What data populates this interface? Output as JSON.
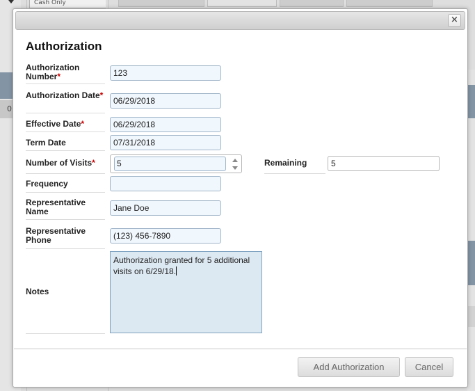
{
  "background": {
    "cash_label": "Cash Only",
    "row_value": "0"
  },
  "dialog": {
    "close_glyph": "×",
    "title": "Authorization",
    "fields": {
      "auth_number": {
        "label": "Authorization Number",
        "required": "*",
        "value": "123"
      },
      "auth_date": {
        "label": "Authorization Date",
        "required": "*",
        "value": "06/29/2018"
      },
      "effective_date": {
        "label": "Effective Date",
        "required": "*",
        "value": "06/29/2018"
      },
      "term_date": {
        "label": "Term Date",
        "value": "07/31/2018"
      },
      "visits": {
        "label": "Number of Visits",
        "required": "*",
        "value": "5"
      },
      "remaining": {
        "label": "Remaining",
        "value": "5"
      },
      "frequency": {
        "label": "Frequency",
        "value": ""
      },
      "rep_name": {
        "label": "Representative Name",
        "value": "Jane Doe"
      },
      "rep_phone": {
        "label": "Representative Phone",
        "value": "(123) 456-7890"
      },
      "notes": {
        "label": "Notes",
        "value": "Authorization granted for 5 additional visits on 6/29/18."
      }
    },
    "buttons": {
      "add": "Add Authorization",
      "cancel": "Cancel"
    }
  },
  "colors": {
    "required": "#cc0000",
    "input_bg": "#f0f7fd",
    "notes_bg": "#dde9f2",
    "header_blue": "#8c9eaf"
  },
  "icons": [
    "close-icon",
    "chevron-up-icon",
    "chevron-down-icon",
    "dropdown-arrow-icon"
  ]
}
